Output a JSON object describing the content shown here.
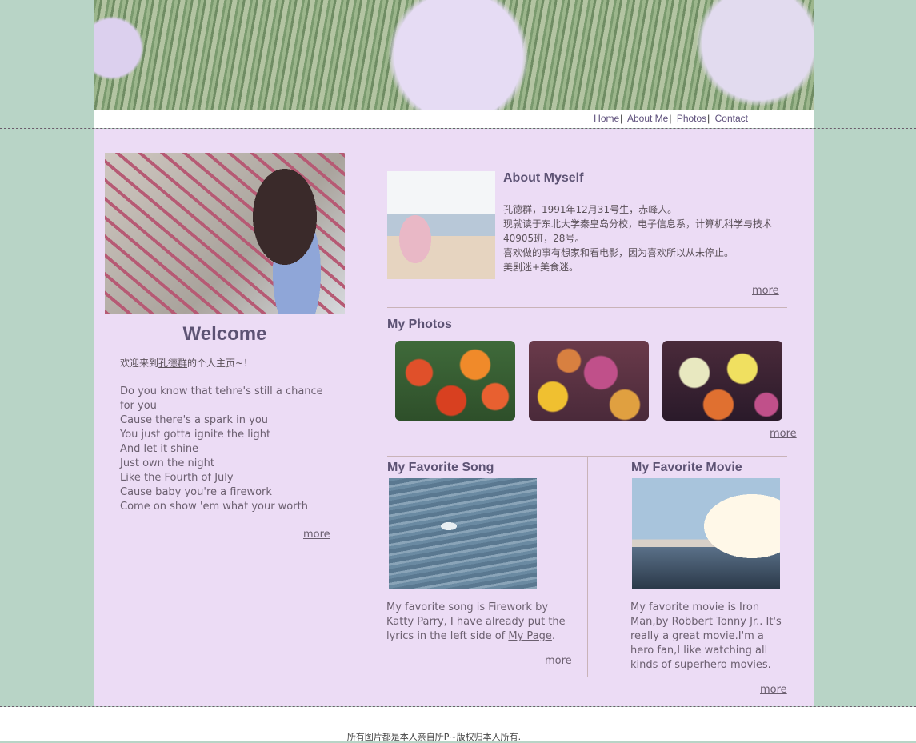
{
  "nav": {
    "items": [
      "Home",
      "About Me",
      "Photos",
      "Contact"
    ],
    "separator": "|"
  },
  "welcome": {
    "title": "Welcome",
    "intro_prefix": "欢迎来到",
    "intro_name": "孔德群",
    "intro_suffix": "的个人主页~！",
    "lyrics": [
      "Do you know that tehre's still a chance",
      "for you",
      "Cause there's a spark in you",
      "You just gotta ignite the light",
      "And let it shine",
      "Just own the night",
      "Like the Fourth of July",
      "Cause baby you're a firework",
      "Come on show 'em what your worth"
    ],
    "more": "more"
  },
  "about": {
    "title": "About Myself",
    "lines": [
      "孔德群，1991年12月31号生，赤峰人。",
      "现就读于东北大学秦皇岛分校，电子信息系，计算机科学与技术",
      "40905班，28号。",
      "喜欢做的事有想家和看电影，因为喜欢所以从未停止。",
      "美剧迷+美食迷。"
    ],
    "more": "more"
  },
  "photos": {
    "title": "My Photos",
    "more": "more"
  },
  "song": {
    "title": "My Favorite Song",
    "text_prefix": "My favorite song is Firework by Katty Parry, I have already put the lyrics in the left side of ",
    "link": "My Page",
    "text_suffix": ".",
    "more": "more"
  },
  "movie": {
    "title": "My Favorite Movie",
    "text": "My favorite movie is Iron Man,by Robbert Tonny Jr.. It's really a great movie.I'm a hero fan,I like watching all kinds of superhero movies.",
    "more": "more"
  },
  "footer": {
    "text": "所有图片都是本人亲自所P~版权归本人所有."
  },
  "colors": {
    "page_bg": "#b8d4c6",
    "content_bg": "#ecdcf5",
    "heading": "#5d5374"
  }
}
